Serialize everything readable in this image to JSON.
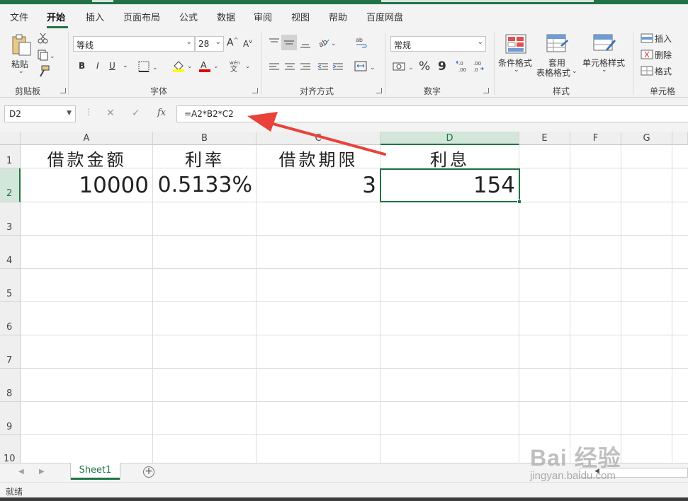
{
  "menu": {
    "tabs": [
      "文件",
      "开始",
      "插入",
      "页面布局",
      "公式",
      "数据",
      "审阅",
      "视图",
      "帮助",
      "百度网盘"
    ],
    "active": "开始"
  },
  "ribbon": {
    "clipboard": {
      "paste": "粘贴",
      "label": "剪贴板"
    },
    "font": {
      "name": "等线",
      "size": "28",
      "bold": "B",
      "italic": "I",
      "underline": "U",
      "label": "字体"
    },
    "alignment": {
      "label": "对齐方式"
    },
    "number": {
      "format": "常规",
      "percent": "%",
      "comma": "9",
      "label": "数字"
    },
    "styles": {
      "conditional": "条件格式",
      "table_line1": "套用",
      "table_line2": "表格格式",
      "cell_styles": "单元格样式",
      "label": "样式"
    },
    "cells": {
      "insert": "插入",
      "delete": "删除",
      "format": "格式",
      "label": "单元格"
    }
  },
  "formula_bar": {
    "name_box": "D2",
    "fx": "fx",
    "formula": "=A2*B2*C2"
  },
  "columns": [
    "A",
    "B",
    "C",
    "D",
    "E",
    "F",
    "G"
  ],
  "rows": [
    "1",
    "2",
    "3",
    "4",
    "5",
    "6",
    "7",
    "8",
    "9",
    "10"
  ],
  "cells": {
    "A1": "借款金额",
    "B1": "利率",
    "C1": "借款期限",
    "D1": "利息",
    "A2": "10000",
    "B2": "0.5133%",
    "C2": "3",
    "D2": "154"
  },
  "selected_cell": "D2",
  "sheet_tabs": [
    "Sheet1"
  ],
  "status": "就绪",
  "watermark": {
    "title": "Bai 经验",
    "subtitle": "jingyan.baidu.com"
  },
  "colors": {
    "accent": "#217346",
    "arrow": "#e8423a"
  }
}
